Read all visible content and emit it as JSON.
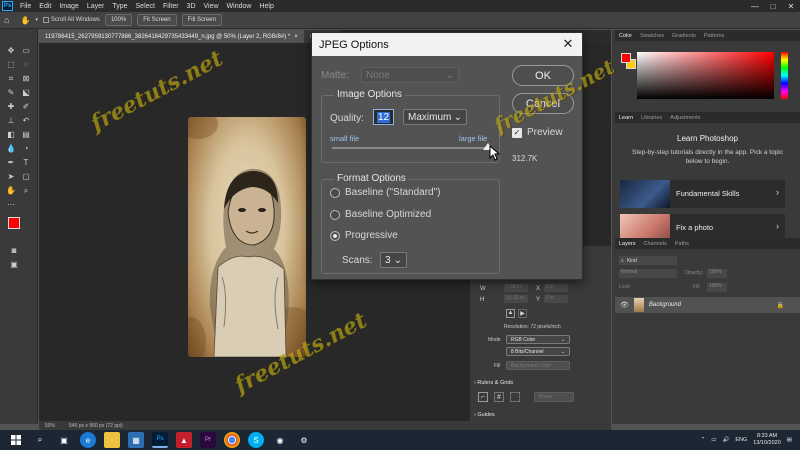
{
  "menubar": {
    "logo": "Ps",
    "items": [
      "File",
      "Edit",
      "Image",
      "Layer",
      "Type",
      "Select",
      "Filter",
      "3D",
      "View",
      "Window",
      "Help"
    ],
    "window_controls": [
      "—",
      "□",
      "✕"
    ]
  },
  "options_bar": {
    "scroll_all_windows": "Scroll All Windows",
    "zoom": "100%",
    "fit_screen": "Fit Screen",
    "fill_screen": "Fill Screen"
  },
  "document": {
    "active_tab": "119786415_2627959130777886_3826418429735433449_n.jpg @ 50% (Layer 2, RGB/8#) *",
    "inactive_tab": "old_pape",
    "status_zoom": "50%",
    "status_info": "546 px x 960 px (72 ppi)"
  },
  "watermark": "freetuts.net",
  "dialog": {
    "title": "JPEG Options",
    "close": "✕",
    "matte_label": "Matte:",
    "matte_value": "None",
    "image_options_legend": "Image Options",
    "quality_label": "Quality:",
    "quality_value": "12",
    "quality_preset": "Maximum",
    "small_file": "small file",
    "large_file": "large file",
    "quality_slider_fraction": 1.0,
    "format_options_legend": "Format Options",
    "format_options": [
      "Baseline (\"Standard\")",
      "Baseline Optimized",
      "Progressive"
    ],
    "selected_format": "Progressive",
    "scans_label": "Scans:",
    "scans_value": "3",
    "ok": "OK",
    "cancel": "Cancel",
    "preview_label": "Preview",
    "preview_checked": true,
    "file_size": "312.7K"
  },
  "color_panel": {
    "tabs": [
      "Color",
      "Swatches",
      "Gradients",
      "Patterns"
    ],
    "foreground": "#ff0000",
    "background": "#ffcc00"
  },
  "learn_panel": {
    "tabs": [
      "Learn",
      "Libraries",
      "Adjustments"
    ],
    "heading": "Learn Photoshop",
    "description": "Step-by-step tutorials directly in the app. Pick a topic below to begin.",
    "cards": [
      "Fundamental Skills",
      "Fix a photo"
    ]
  },
  "layers_panel": {
    "tabs": [
      "Layers",
      "Channels",
      "Paths"
    ],
    "kind": "Kind",
    "blend_mode": "Normal",
    "opacity_label": "Opacity:",
    "opacity": "100%",
    "lock_label": "Lock:",
    "fill_label": "Fill:",
    "fill": "100%",
    "layer_name": "Background"
  },
  "properties_panel": {
    "w_label": "W",
    "w_value": "7.58 in",
    "h_label": "H",
    "h_value": "13.33 in",
    "x_label": "X",
    "x_value": "0 in",
    "y_label": "Y",
    "y_value": "0 in",
    "resolution": "Resolution: 72 pixels/inch",
    "mode_label": "Mode",
    "mode_value": "RGB Color",
    "bits_value": "8 Bits/Channel",
    "fill_label": "Fill",
    "fill_value": "Background Color",
    "rulers_grids": "Rulers & Grids",
    "units": "Pixels",
    "guides": "Guides"
  },
  "taskbar": {
    "apps": [
      "search",
      "task-view",
      "edge",
      "file-explorer",
      "store",
      "photoshop",
      "app-red",
      "premiere",
      "chrome",
      "skype",
      "steam",
      "settings"
    ],
    "language": "ENG",
    "time": "8:33 AM",
    "date": "13/10/2020"
  }
}
